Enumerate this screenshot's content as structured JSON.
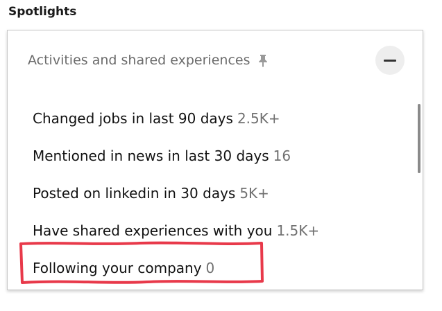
{
  "section_label": "Spotlights",
  "panel": {
    "header": "Activities and shared experiences",
    "pin_icon": "pin-icon",
    "collapse_icon": "minus-icon"
  },
  "items": [
    {
      "label": "Changed jobs in last 90 days",
      "count": "2.5K+"
    },
    {
      "label": "Mentioned in news in last 30 days",
      "count": "16"
    },
    {
      "label": "Posted on linkedin in 30 days",
      "count": "5K+"
    },
    {
      "label": "Have shared experiences with you",
      "count": "1.5K+"
    },
    {
      "label": "Following your company",
      "count": "0"
    }
  ],
  "annotation": {
    "color": "#e8394a",
    "target": "Following your company"
  }
}
